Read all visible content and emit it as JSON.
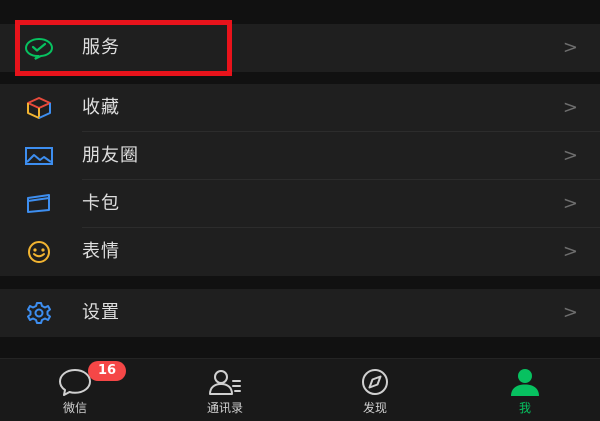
{
  "menu": {
    "groups": [
      {
        "items": [
          {
            "label": "服务",
            "icon": "wechat-pay-icon",
            "chevron": ">"
          }
        ]
      },
      {
        "items": [
          {
            "label": "收藏",
            "icon": "favorites-cube-icon",
            "chevron": ">"
          },
          {
            "label": "朋友圈",
            "icon": "moments-picture-icon",
            "chevron": ">"
          },
          {
            "label": "卡包",
            "icon": "card-wallet-icon",
            "chevron": ">"
          },
          {
            "label": "表情",
            "icon": "smiley-face-icon",
            "chevron": ">"
          }
        ]
      },
      {
        "items": [
          {
            "label": "设置",
            "icon": "gear-icon",
            "chevron": ">"
          }
        ]
      }
    ]
  },
  "tabbar": {
    "tabs": [
      {
        "label": "微信",
        "icon": "chat-bubble-icon",
        "badge": "16",
        "active": false
      },
      {
        "label": "通讯录",
        "icon": "contacts-icon",
        "active": false
      },
      {
        "label": "发现",
        "icon": "compass-icon",
        "active": false
      },
      {
        "label": "我",
        "icon": "person-icon",
        "active": true
      }
    ]
  },
  "colors": {
    "background": "#111111",
    "cell": "#1f1f1f",
    "accent_green": "#07c160",
    "highlight_red": "#e8131b",
    "badge_red": "#f54747",
    "settings_blue": "#3d8ef0"
  }
}
